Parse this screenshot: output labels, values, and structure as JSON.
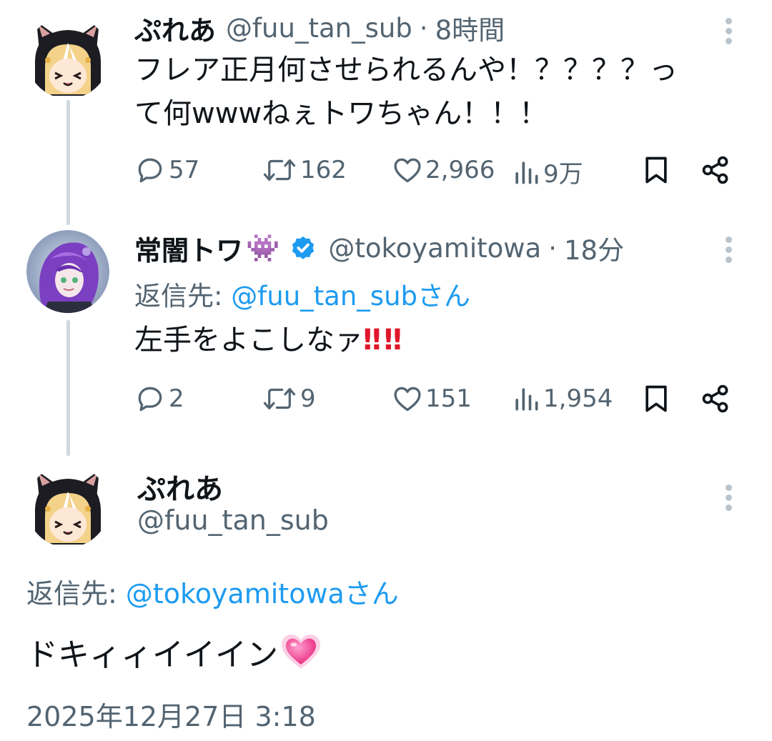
{
  "tweets": [
    {
      "name": "ぷれあ",
      "handle": "@fuu_tan_sub",
      "separator": "·",
      "time": "8時間",
      "text_line1": "フレア正月何させられるんや！？？？？っ",
      "text_line2": "て何wwwねぇトワちゃん！！！",
      "replies": "57",
      "retweets": "162",
      "likes": "2,966",
      "views": "9万"
    },
    {
      "name": "常闇トワ",
      "name_emoji": "👾",
      "handle": "@tokoyamitowa",
      "separator": "·",
      "time": "18分",
      "reply_prefix": "返信先: ",
      "reply_to": "@fuu_tan_subさん",
      "text": "左手をよこしなァ",
      "text_emoji": "‼‼",
      "replies": "2",
      "retweets": "9",
      "likes": "151",
      "views": "1,954"
    }
  ],
  "main_tweet": {
    "name": "ぷれあ",
    "handle": "@fuu_tan_sub",
    "reply_prefix": "返信先: ",
    "reply_to": "@tokoyamitowaさん",
    "text": "ドキィィイイイン",
    "timestamp": "2025年12月27日 3:18"
  },
  "colors": {
    "text": "#0f1419",
    "secondary": "#536471",
    "accent": "#1d9bf0",
    "thread_line": "#cfd9de",
    "verified": "#1d9bf0",
    "emoji_purple": "#8a3fd0",
    "emoji_red": "#e0162b"
  },
  "icons": [
    "reply-icon",
    "retweet-icon",
    "like-icon",
    "views-icon",
    "bookmark-icon",
    "share-icon",
    "more-icon",
    "verified-badge-icon"
  ]
}
